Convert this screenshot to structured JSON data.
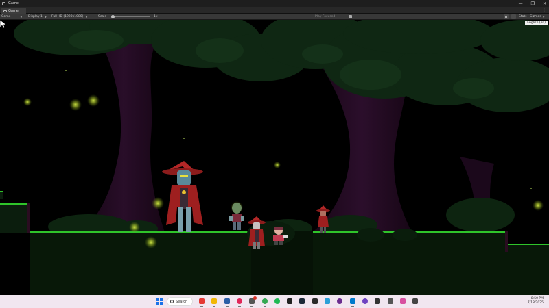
{
  "window": {
    "title": "Game"
  },
  "tabs": [
    {
      "label": "Game"
    }
  ],
  "toolbar": {
    "view_mode": "Game",
    "display": "Display 1",
    "resolution": "Full HD (1920x1080)",
    "scale_label": "Scale",
    "scale_value": "1x",
    "play_mode": "Play Focused",
    "stats_label": "Stats",
    "gizmos_label": "Gizmos",
    "language": "English (en)"
  },
  "game_scene": {
    "description_icons": [
      "player-character-icon",
      "boss-character-icon",
      "zombie-enemy-icon",
      "vampire-enemy-icon",
      "imp-enemy-icon"
    ],
    "colors": {
      "grass": "#2fc42a",
      "firefly": "#c9e23a",
      "canopy": "#112a14",
      "trunk": "#2c0d2a",
      "hat_red": "#b32727"
    }
  },
  "taskbar": {
    "search_label": "Search",
    "apps": [
      {
        "name": "paint-icon",
        "color": "#e53935"
      },
      {
        "name": "file-explorer-icon",
        "color": "#f2b705"
      },
      {
        "name": "terminal-icon",
        "color": "#2b5ea7"
      },
      {
        "name": "opera-icon",
        "color": "#e2275a"
      },
      {
        "name": "discord-icon",
        "color": "#555555",
        "badge": "1"
      },
      {
        "name": "chrome-icon",
        "color": "#34a853"
      },
      {
        "name": "spotify-icon",
        "color": "#1db954"
      },
      {
        "name": "command-prompt-icon",
        "color": "#222222"
      },
      {
        "name": "steam-icon",
        "color": "#1b2838"
      },
      {
        "name": "epic-games-icon",
        "color": "#2a2a2a"
      },
      {
        "name": "notepad-icon",
        "color": "#2aa0d8"
      },
      {
        "name": "obs-icon",
        "color": "#6b2d8f"
      },
      {
        "name": "vscode-icon",
        "color": "#007acc"
      },
      {
        "name": "github-desktop-icon",
        "color": "#6f42c1"
      },
      {
        "name": "davinci-icon",
        "color": "#333333"
      },
      {
        "name": "unity-hub-icon",
        "color": "#555555"
      },
      {
        "name": "paint-3d-icon",
        "color": "#d84fa0"
      },
      {
        "name": "unity-icon",
        "color": "#444444"
      }
    ],
    "time": "8:50 PM",
    "date": "7/18/2025"
  }
}
